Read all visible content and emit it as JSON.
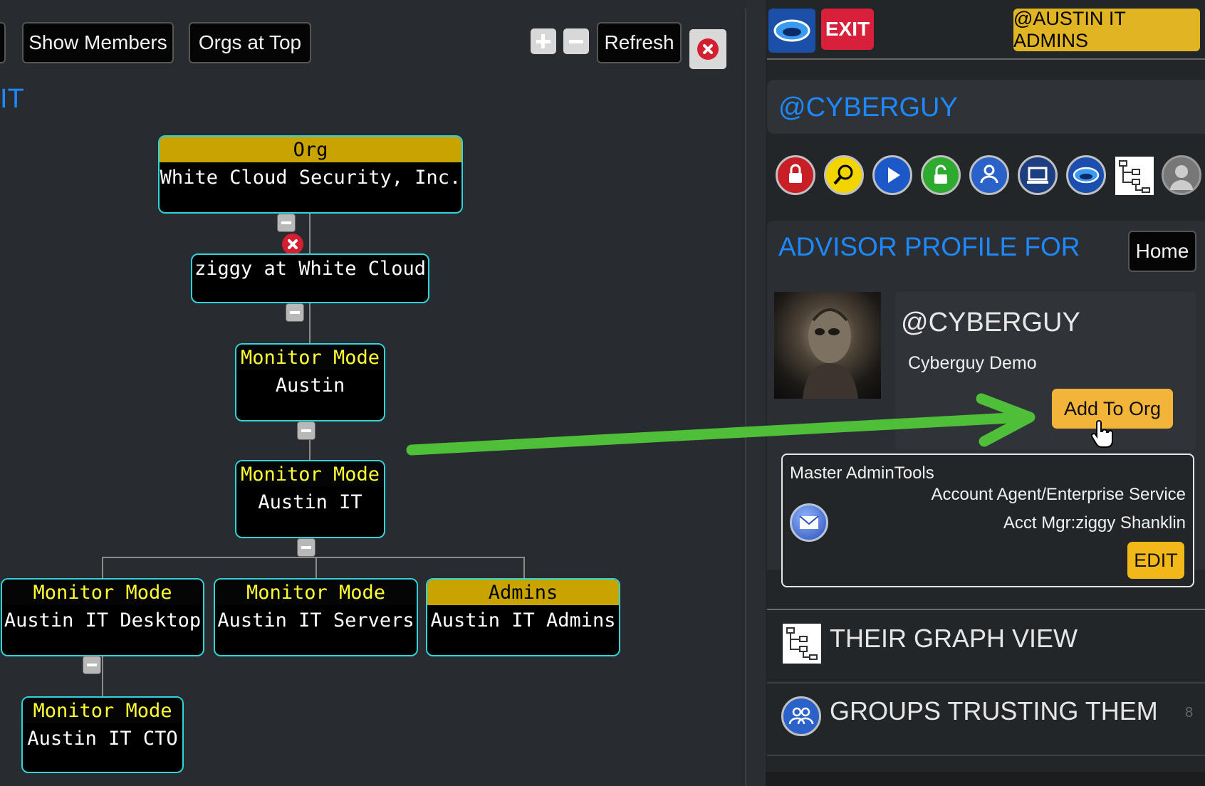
{
  "toolbar": {
    "show_members": "Show Members",
    "orgs_at_top": "Orgs at Top",
    "refresh": "Refresh"
  },
  "graph": {
    "partial_title": "IT",
    "nodes": {
      "org": {
        "header": "Org",
        "label": "White Cloud Security, Inc."
      },
      "ziggy": {
        "label": "ziggy at White Cloud"
      },
      "austin": {
        "header": "Monitor Mode",
        "label": "Austin"
      },
      "austin_it": {
        "header": "Monitor Mode",
        "label": "Austin IT"
      },
      "desktop": {
        "header": "Monitor Mode",
        "label": "Austin IT Desktop"
      },
      "servers": {
        "header": "Monitor Mode",
        "label": "Austin IT Servers"
      },
      "admins": {
        "header": "Admins",
        "label": "Austin IT Admins"
      },
      "cto": {
        "header": "Monitor Mode",
        "label": "Austin IT CTO"
      }
    }
  },
  "profile": {
    "exit": "EXIT",
    "group_badge": "@AUSTIN IT ADMINS",
    "handle_header": "@CYBERGUY",
    "advisor_title": "ADVISOR PROFILE FOR",
    "home": "Home",
    "handle": "@CYBERGUY",
    "display_name": "Cyberguy Demo",
    "add_to_org": "Add To Org",
    "admin_tools_title": "Master AdminTools",
    "account_type": "Account Agent/Enterprise Service",
    "account_manager": "Acct Mgr:ziggy Shanklin",
    "edit": "EDIT",
    "graph_view": "THEIR GRAPH VIEW",
    "groups_trusting": "GROUPS TRUSTING THEM",
    "groups_count": "8"
  },
  "colors": {
    "accent_blue": "#1e88ff",
    "gold": "#c9a300",
    "exit_red": "#d8203a",
    "node_border": "#2fd3d9",
    "arrow_green": "#4fbf3a"
  }
}
